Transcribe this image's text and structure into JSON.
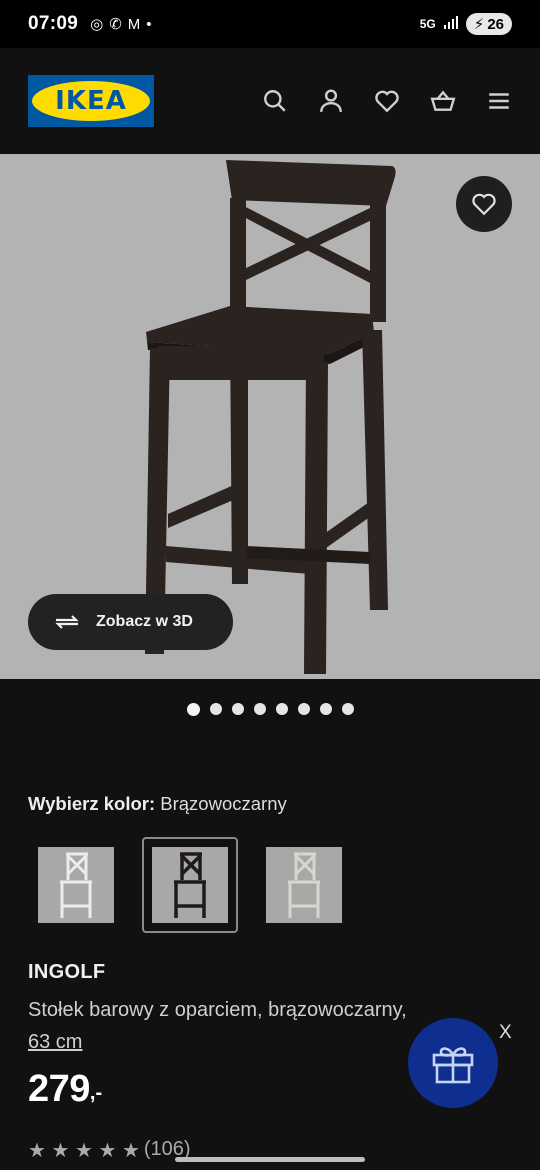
{
  "status_bar": {
    "time": "07:09",
    "notification_icons": [
      "chrome-icon",
      "call-icon",
      "gmail-icon",
      "dot-icon"
    ],
    "network": "5G",
    "battery": "26"
  },
  "header": {
    "logo_text": "IKEA",
    "icons": [
      "search-icon",
      "account-icon",
      "favorites-icon",
      "cart-icon",
      "menu-icon"
    ]
  },
  "gallery": {
    "view_3d_label": "Zobacz w 3D",
    "dot_count": 8,
    "active_dot": 0
  },
  "color_picker": {
    "label": "Wybierz kolor:",
    "value": "Brązowoczarny",
    "swatches": [
      {
        "name": "white",
        "selected": false
      },
      {
        "name": "brown-black",
        "selected": true
      },
      {
        "name": "white-stain",
        "selected": false
      }
    ]
  },
  "product": {
    "name": "INGOLF",
    "description": "Stołek barowy z oparciem, brązowoczarny,",
    "size": "63 cm",
    "price": "279",
    "price_suffix": ",-",
    "rating_text": "(106)"
  },
  "promo": {
    "close_label": "X"
  },
  "colors": {
    "ikea_blue": "#0058a3",
    "ikea_yellow": "#ffdb00",
    "gift_button": "#0e2f8f",
    "background": "#111111",
    "image_bg": "#b3b3b3"
  }
}
